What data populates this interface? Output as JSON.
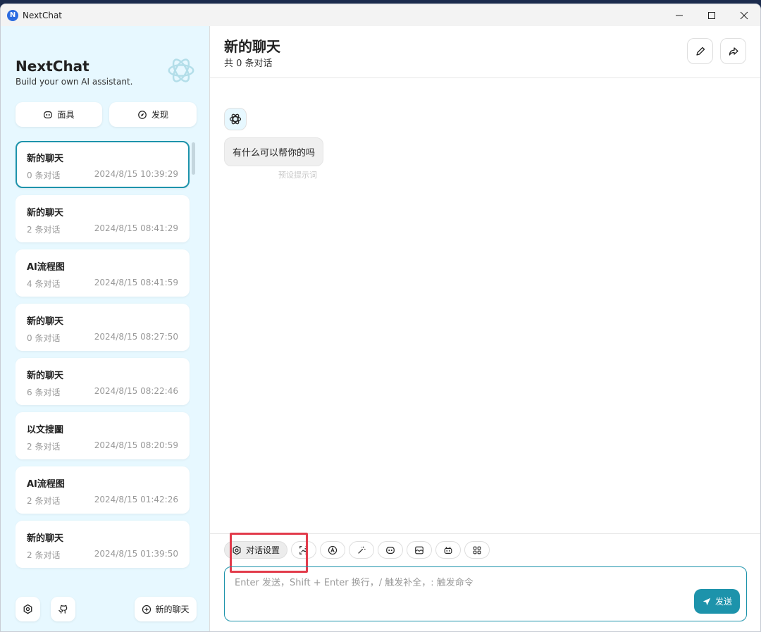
{
  "window": {
    "title": "NextChat",
    "app_logo_letter": "N"
  },
  "sidebar": {
    "brand_title": "NextChat",
    "brand_subtitle": "Build your own AI assistant.",
    "mask_button_label": "面具",
    "discover_button_label": "发现",
    "new_chat_label": "新的聊天",
    "chats": [
      {
        "title": "新的聊天",
        "count": "0 条对话",
        "date": "2024/8/15 10:39:29",
        "selected": true
      },
      {
        "title": "新的聊天",
        "count": "2 条对话",
        "date": "2024/8/15 08:41:29",
        "selected": false
      },
      {
        "title": "AI流程图",
        "count": "4 条对话",
        "date": "2024/8/15 08:41:59",
        "selected": false
      },
      {
        "title": "新的聊天",
        "count": "0 条对话",
        "date": "2024/8/15 08:27:50",
        "selected": false
      },
      {
        "title": "新的聊天",
        "count": "6 条对话",
        "date": "2024/8/15 08:22:46",
        "selected": false
      },
      {
        "title": "以文搜圖",
        "count": "2 条对话",
        "date": "2024/8/15 08:20:59",
        "selected": false
      },
      {
        "title": "AI流程图",
        "count": "2 条对话",
        "date": "2024/8/15 01:42:26",
        "selected": false
      },
      {
        "title": "新的聊天",
        "count": "2 条对话",
        "date": "2024/8/15 01:39:50",
        "selected": false
      }
    ]
  },
  "main": {
    "title": "新的聊天",
    "subtitle": "共 0 条对话",
    "message": {
      "text": "有什么可以帮你的吗",
      "meta": "预设提示词"
    },
    "toolbar": {
      "settings_label": "对话设置",
      "tools": [
        "image-icon",
        "translate-icon",
        "magic-wand-icon",
        "mask-icon",
        "image-frame-icon",
        "robot-icon",
        "apps-grid-icon"
      ]
    },
    "input": {
      "placeholder": "Enter 发送，Shift + Enter 换行，/ 触发补全，: 触发命令",
      "value": ""
    },
    "send_label": "发送"
  },
  "colors": {
    "accent": "#1d93ab",
    "sidebar_bg": "#e7f8ff",
    "highlight": "#e23b4b"
  }
}
